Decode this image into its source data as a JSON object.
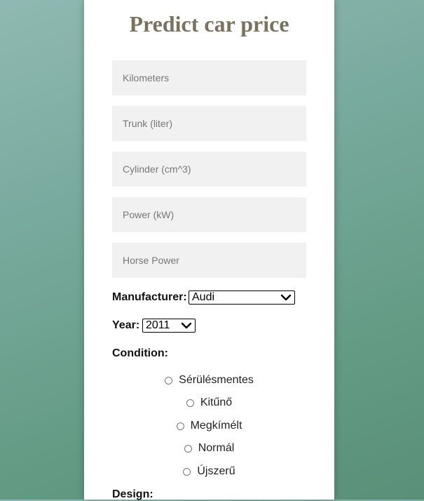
{
  "form": {
    "title": "Predict car price",
    "inputs": [
      {
        "placeholder": "Kilometers",
        "value": ""
      },
      {
        "placeholder": "Trunk (liter)",
        "value": ""
      },
      {
        "placeholder": "Cylinder (cm^3)",
        "value": ""
      },
      {
        "placeholder": "Power (kW)",
        "value": ""
      },
      {
        "placeholder": "Horse Power",
        "value": ""
      }
    ],
    "manufacturer": {
      "label": "Manufacturer:",
      "selected": "Audi"
    },
    "year": {
      "label": "Year:",
      "selected": "2011"
    },
    "condition": {
      "label": "Condition:",
      "options": [
        "Sérülésmentes",
        "Kitűnő",
        "Megkímélt",
        "Normál",
        "Újszerű"
      ]
    },
    "design": {
      "label": "Design:"
    }
  }
}
